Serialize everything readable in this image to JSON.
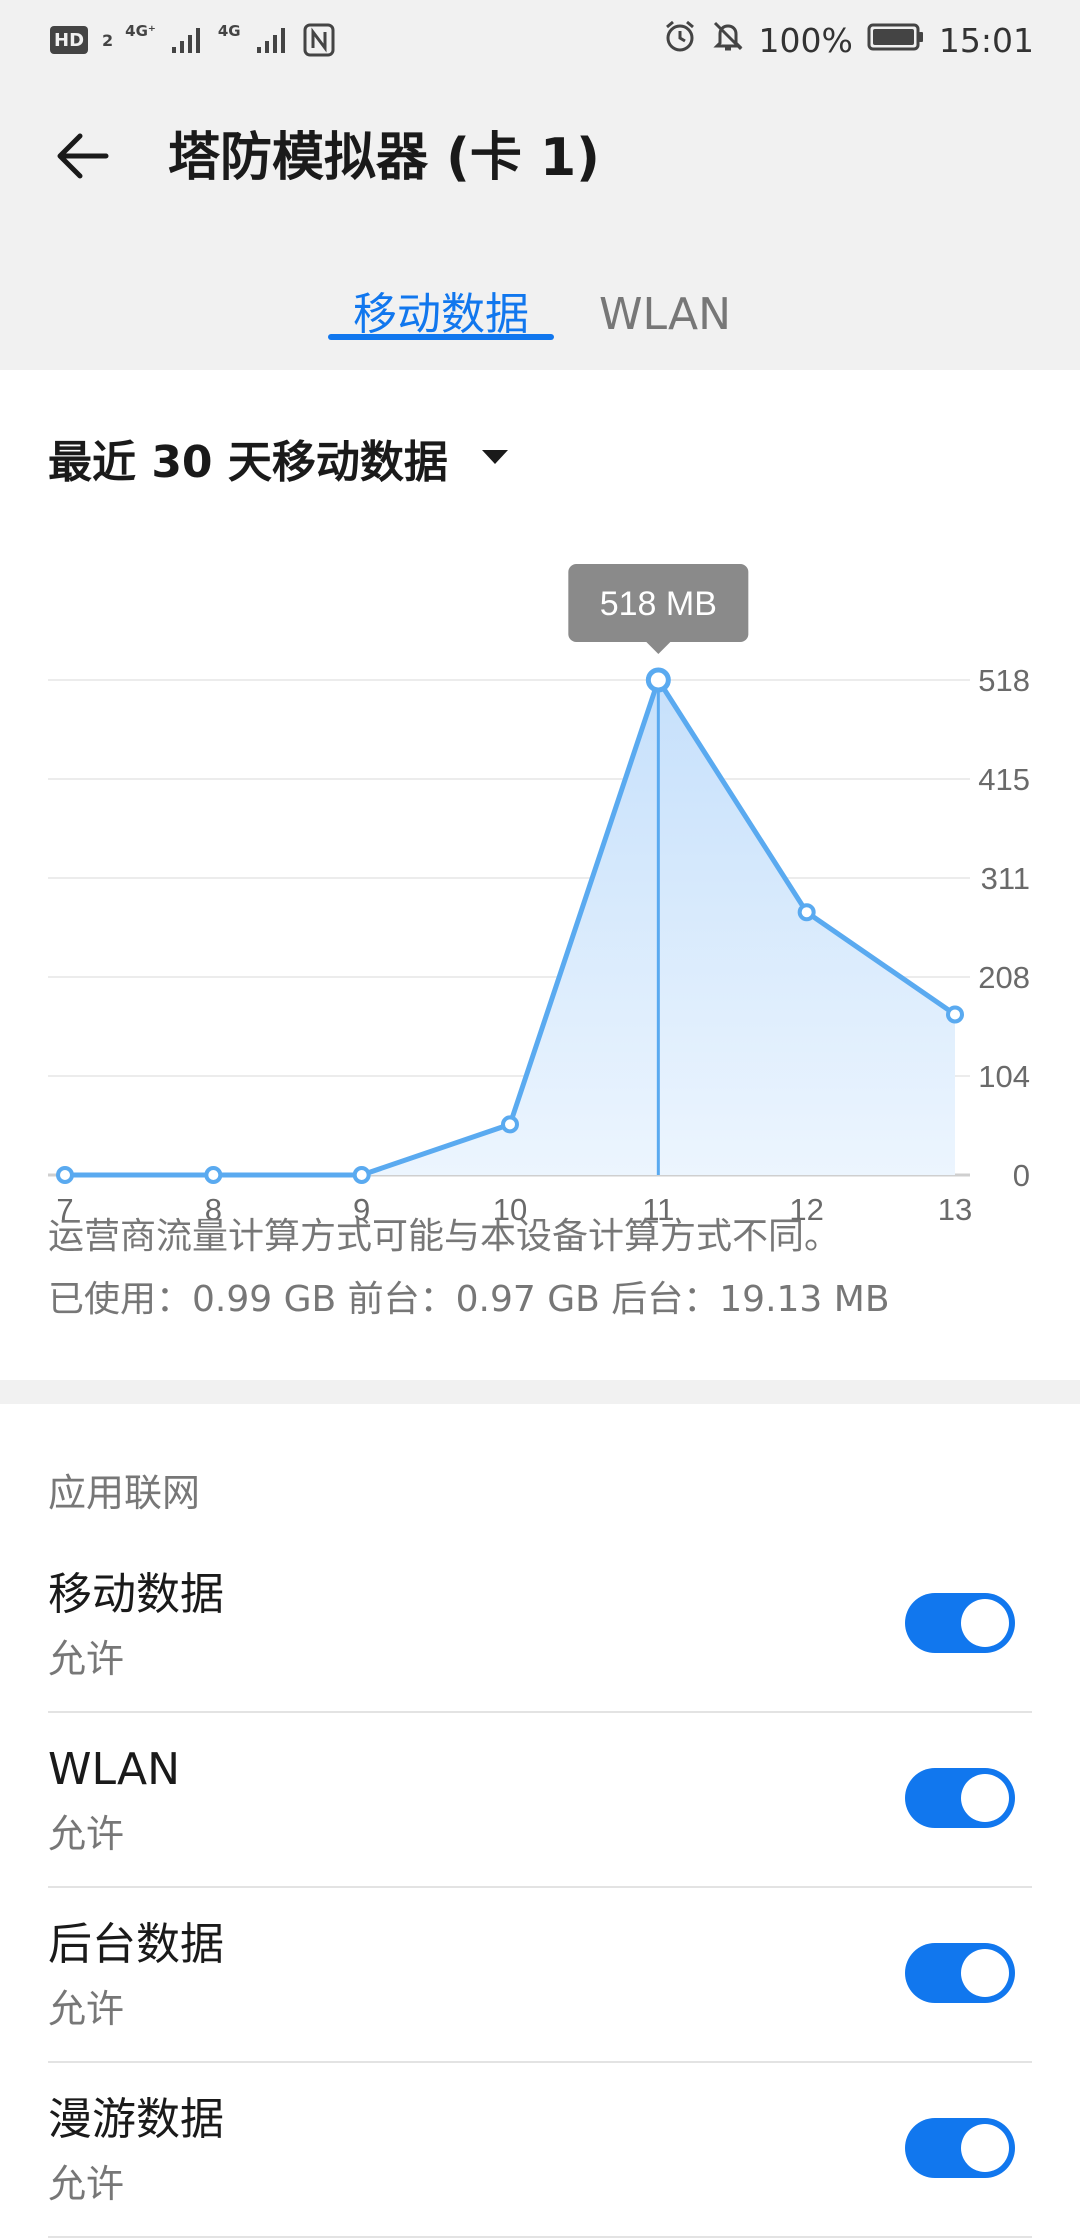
{
  "status_bar": {
    "network_badge": "HD",
    "network_badge_sub": "2",
    "network_type_1": "4G⁺",
    "network_type_2": "4G",
    "battery": "100%",
    "time": "15:01",
    "icons": [
      "hd-icon",
      "signal-icon",
      "signal-icon",
      "nfc-icon",
      "alarm-icon",
      "mute-bell-icon",
      "battery-icon"
    ]
  },
  "header": {
    "title": "塔防模拟器 (卡 1)",
    "back_icon": "arrow-left-icon"
  },
  "tabs": [
    {
      "label": "移动数据",
      "selected": true
    },
    {
      "label": "WLAN",
      "selected": false
    }
  ],
  "period": {
    "label": "最近 30 天移动数据",
    "icon": "triangle-down-icon"
  },
  "chart_data": {
    "type": "area",
    "title": "",
    "xlabel": "",
    "ylabel": "",
    "categories": [
      "7",
      "8",
      "9",
      "10",
      "11",
      "12",
      "13"
    ],
    "values": [
      0,
      0,
      0,
      53,
      518,
      275,
      168
    ],
    "yticks": [
      "518",
      "415",
      "311",
      "208",
      "104",
      "0"
    ],
    "ylim": [
      0,
      518
    ],
    "highlight": {
      "category": "11",
      "label": "518 MB"
    },
    "grid": true,
    "colors": {
      "line": "#5aaaf0",
      "fill_top": "#c6e0fb",
      "fill_bottom": "#ecf5fe",
      "tooltip": "#8a8a8a"
    }
  },
  "note": "运营商流量计算方式可能与本设备计算方式不同。",
  "usage": "已使用：0.99 GB 前台：0.97 GB 后台：19.13 MB",
  "network_section": {
    "title": "应用联网",
    "rows": [
      {
        "title": "移动数据",
        "subtitle": "允许",
        "enabled": true
      },
      {
        "title": "WLAN",
        "subtitle": "允许",
        "enabled": true
      },
      {
        "title": "后台数据",
        "subtitle": "允许",
        "enabled": true
      },
      {
        "title": "漫游数据",
        "subtitle": "允许",
        "enabled": true
      }
    ]
  },
  "colors": {
    "accent": "#1177ee",
    "background": "#f1f1f1"
  }
}
